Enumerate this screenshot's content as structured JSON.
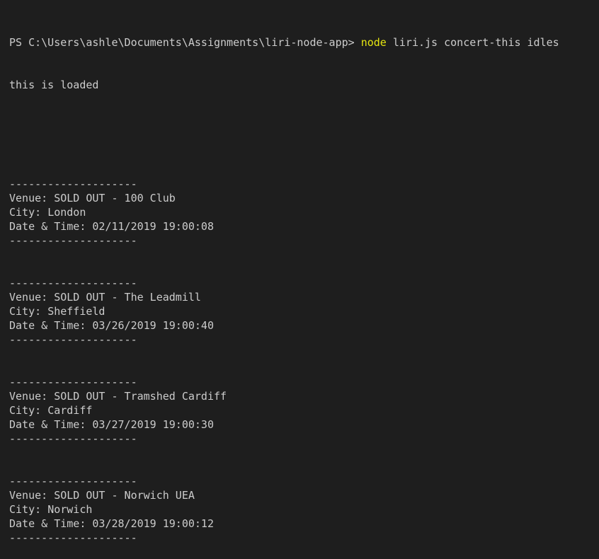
{
  "terminal": {
    "prompt": "PS C:\\Users\\ashle\\Documents\\Assignments\\liri-node-app> ",
    "command_keyword": "node",
    "command_args": " liri.js concert-this idles",
    "output_first": "this is loaded",
    "separator": "--------------------",
    "venue_prefix": "Venue: ",
    "city_prefix": "City: ",
    "date_prefix": "Date & Time: ",
    "events": [
      {
        "venue": "SOLD OUT - 100 Club",
        "city": "London",
        "datetime": "02/11/2019 19:00:08"
      },
      {
        "venue": "SOLD OUT - The Leadmill",
        "city": "Sheffield",
        "datetime": "03/26/2019 19:00:40"
      },
      {
        "venue": "SOLD OUT - Tramshed Cardiff",
        "city": "Cardiff",
        "datetime": "03/27/2019 19:00:30"
      },
      {
        "venue": "SOLD OUT - Norwich UEA",
        "city": "Norwich",
        "datetime": "03/28/2019 19:00:12"
      }
    ]
  },
  "colors": {
    "background": "#1e1e1e",
    "text": "#cccccc",
    "command_highlight": "#e5e510"
  }
}
